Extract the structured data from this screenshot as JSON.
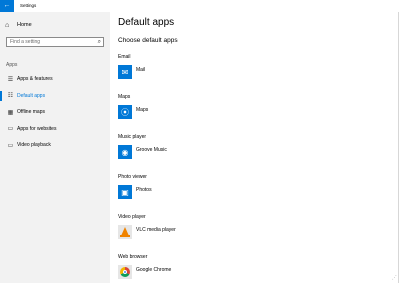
{
  "window": {
    "back_glyph": "←",
    "title": "Settings"
  },
  "sidebar": {
    "home": {
      "icon": "home-icon",
      "glyph": "⌂",
      "label": "Home"
    },
    "search": {
      "placeholder": "Find a setting",
      "icon": "search-icon",
      "glyph": "⌕"
    },
    "section": "Apps",
    "items": [
      {
        "icon": "apps-list-icon",
        "glyph": "☰",
        "label": "Apps & features",
        "active": false
      },
      {
        "icon": "default-apps-icon",
        "glyph": "☷",
        "label": "Default apps",
        "active": true
      },
      {
        "icon": "map-icon",
        "glyph": "▦",
        "label": "Offline maps",
        "active": false
      },
      {
        "icon": "website-icon",
        "glyph": "▭",
        "label": "Apps for websites",
        "active": false
      },
      {
        "icon": "video-icon",
        "glyph": "▭",
        "label": "Video playback",
        "active": false
      }
    ]
  },
  "main": {
    "title": "Default apps",
    "subtitle": "Choose default apps",
    "groups": [
      {
        "category": "Email",
        "app": "Mail",
        "icon": "mail-icon",
        "glyph": "✉",
        "accent": "#0078d7"
      },
      {
        "category": "Maps",
        "app": "Maps",
        "icon": "maps-pin-icon",
        "glyph": "⦿",
        "accent": "#0078d7"
      },
      {
        "category": "Music player",
        "app": "Groove Music",
        "icon": "groove-music-icon",
        "glyph": "◉",
        "accent": "#0078d7"
      },
      {
        "category": "Photo viewer",
        "app": "Photos",
        "icon": "photos-icon",
        "glyph": "▣",
        "accent": "#0078d7"
      },
      {
        "category": "Video player",
        "app": "VLC media player",
        "icon": "vlc-icon",
        "glyph": "",
        "accent": "#f08300"
      },
      {
        "category": "Web browser",
        "app": "Google Chrome",
        "icon": "chrome-icon",
        "glyph": "",
        "accent": "#4285f4"
      }
    ]
  }
}
